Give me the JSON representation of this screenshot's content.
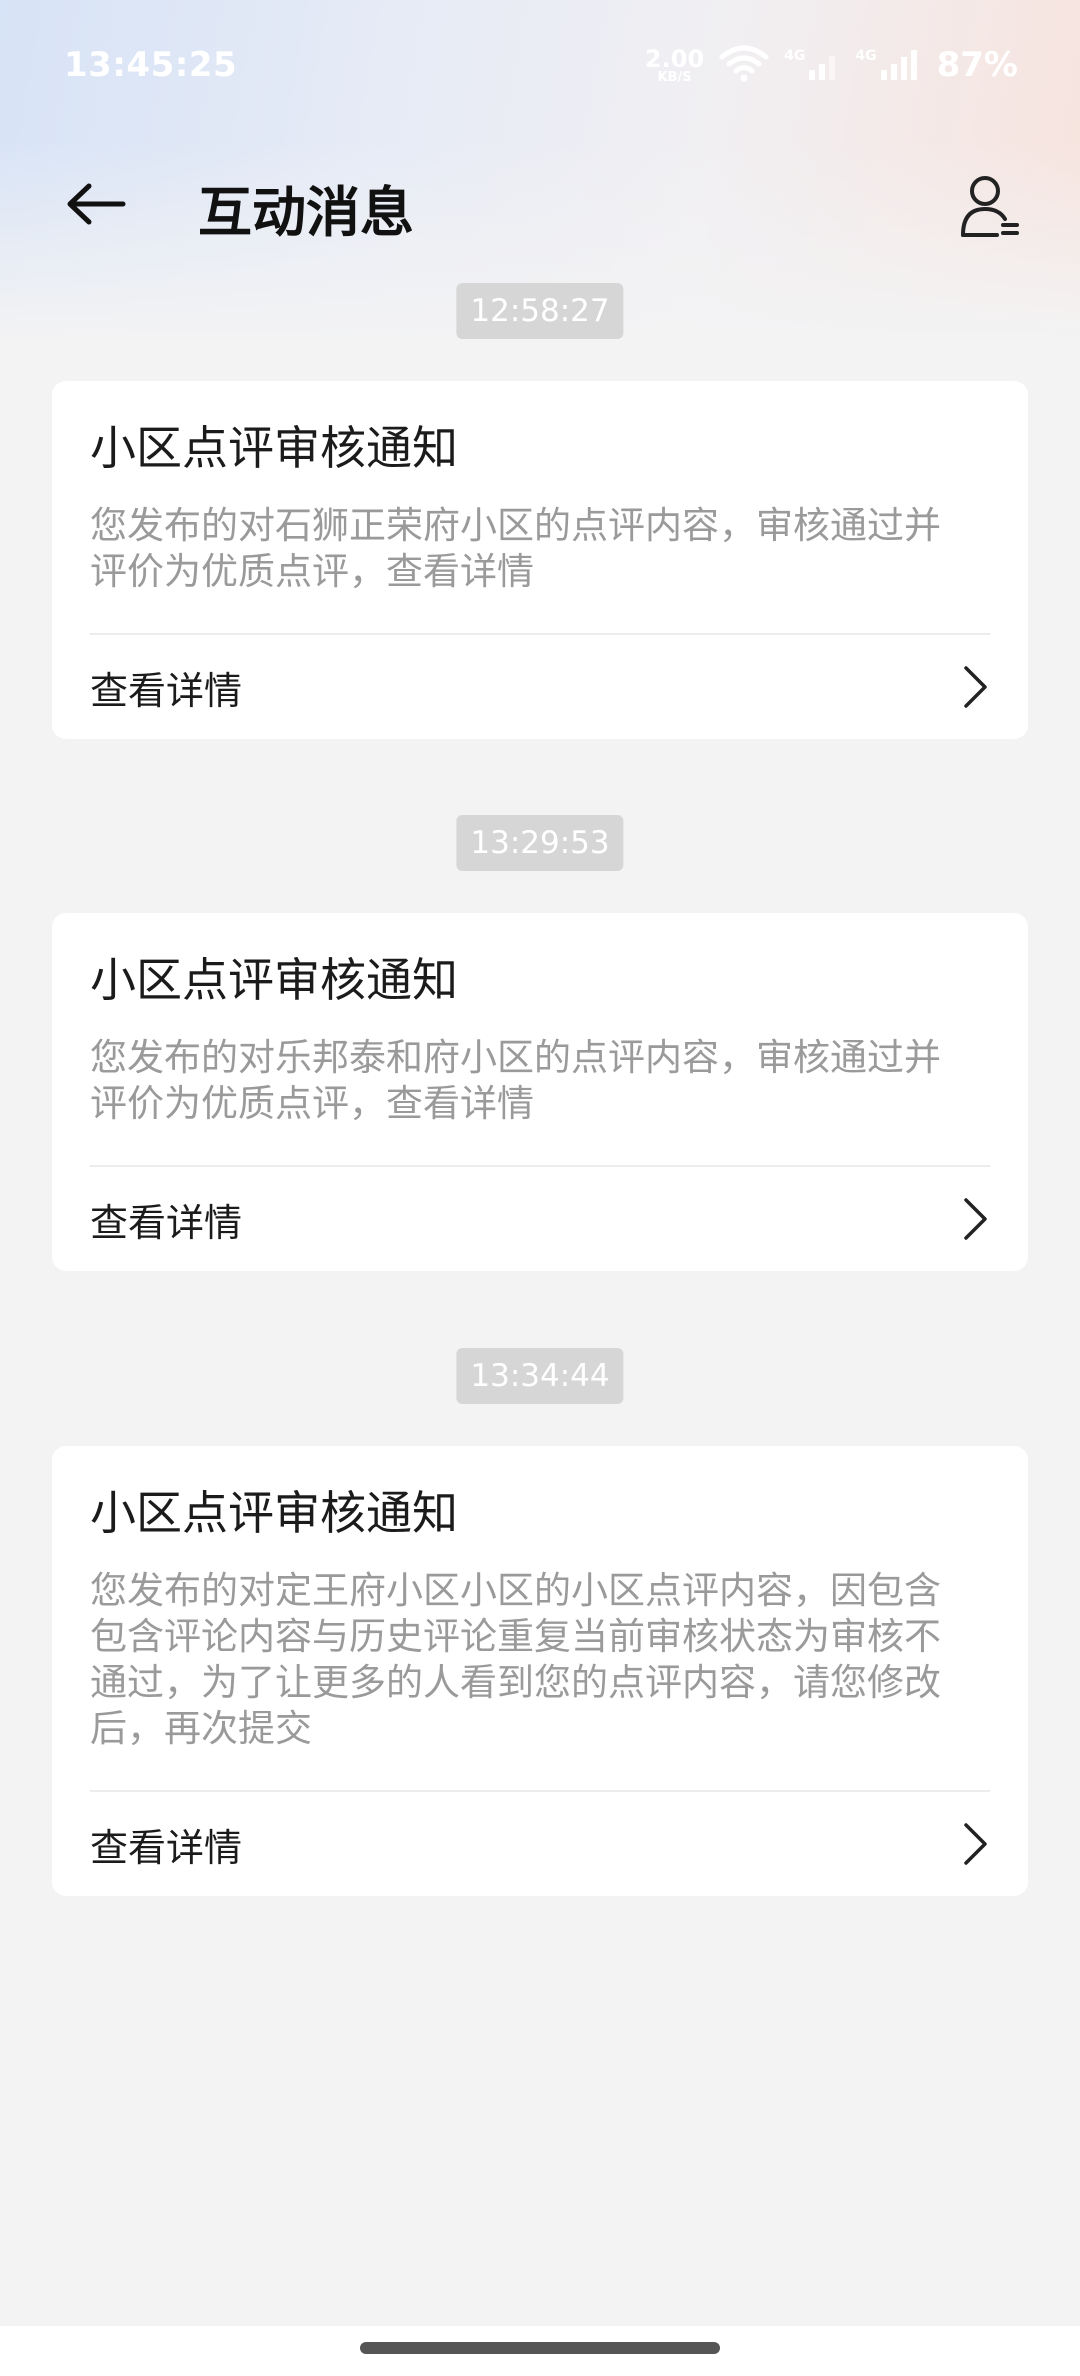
{
  "status_bar": {
    "time": "13:45:25",
    "net_speed_value": "2.00",
    "net_speed_unit": "KB/S",
    "signal_label": "4G",
    "battery": "87%"
  },
  "header": {
    "title": "互动消息"
  },
  "messages": [
    {
      "time": "12:58:27",
      "title": "小区点评审核通知",
      "body_lines": [
        "您发布的对石狮正荣府小区的点评内容，审核通过并",
        "评价为优质点评，查看详情"
      ],
      "link": "查看详情"
    },
    {
      "time": "13:29:53",
      "title": "小区点评审核通知",
      "body_lines": [
        "您发布的对乐邦泰和府小区的点评内容，审核通过并",
        "评价为优质点评，查看详情"
      ],
      "link": "查看详情"
    },
    {
      "time": "13:34:44",
      "title": "小区点评审核通知",
      "body_lines": [
        "您发布的对定王府小区小区的小区点评内容，因包含",
        "包含评论内容与历史评论重复当前审核状态为审核不",
        "通过，为了让更多的人看到您的点评内容，请您修改",
        "后，再次提交"
      ],
      "link": "查看详情"
    }
  ]
}
